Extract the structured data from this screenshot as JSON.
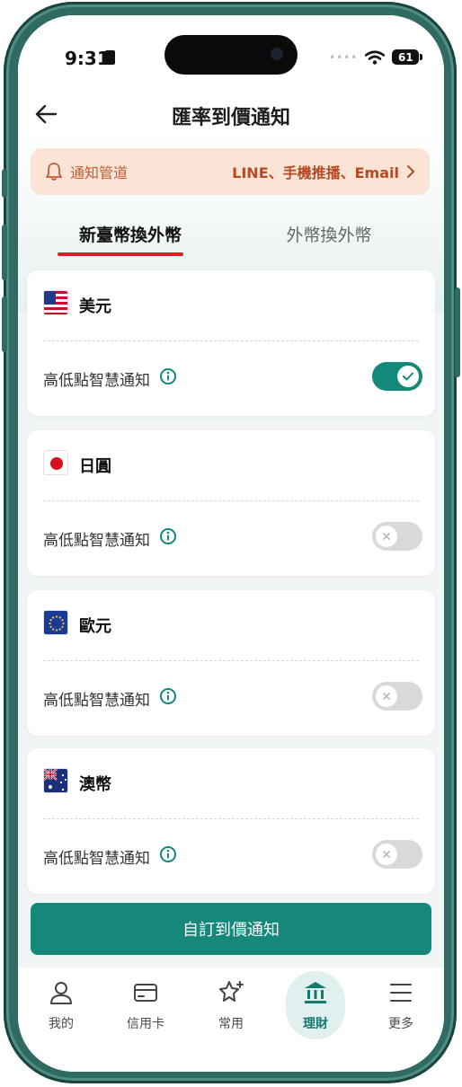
{
  "status_bar": {
    "time": "9:31",
    "battery": "61"
  },
  "header": {
    "title": "匯率到價通知"
  },
  "notice": {
    "label": "通知管道",
    "value": "LINE、手機推播、Email"
  },
  "tabs": [
    {
      "label": "新臺幣換外幣",
      "active": true
    },
    {
      "label": "外幣換外幣",
      "active": false
    }
  ],
  "cards": [
    {
      "currency": "美元",
      "flag": "us-flag-icon",
      "option_label": "高低點智慧通知",
      "enabled": true
    },
    {
      "currency": "日圓",
      "flag": "japan-flag-icon",
      "option_label": "高低點智慧通知",
      "enabled": false
    },
    {
      "currency": "歐元",
      "flag": "eu-flag-icon",
      "option_label": "高低點智慧通知",
      "enabled": false
    },
    {
      "currency": "澳幣",
      "flag": "australia-flag-icon",
      "option_label": "高低點智慧通知",
      "enabled": false
    }
  ],
  "cta": {
    "label": "自訂到價通知"
  },
  "bottom_nav": [
    {
      "label": "我的",
      "icon": "user-icon",
      "active": false
    },
    {
      "label": "信用卡",
      "icon": "credit-card-icon",
      "active": false
    },
    {
      "label": "常用",
      "icon": "star-plus-icon",
      "active": false
    },
    {
      "label": "理財",
      "icon": "bank-icon",
      "active": true
    },
    {
      "label": "更多",
      "icon": "menu-icon",
      "active": false
    }
  ],
  "colors": {
    "brand": "#15877b",
    "tab_underline": "#dc1f26",
    "notice_bg": "#fbe3d6",
    "notice_text": "#c65b31",
    "frame": "#2f6a63"
  }
}
